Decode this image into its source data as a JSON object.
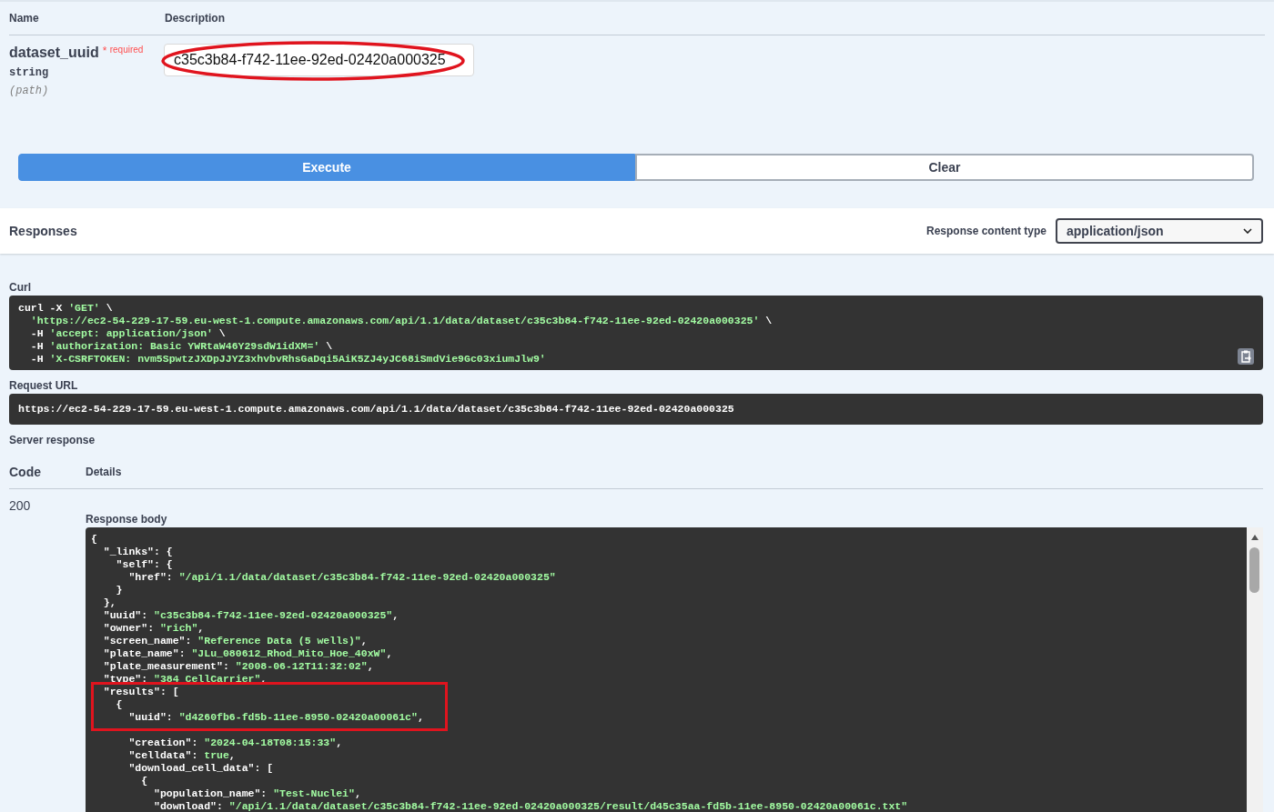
{
  "parameters": {
    "headers": [
      "Name",
      "Description"
    ],
    "param": {
      "name": "dataset_uuid",
      "required_mark": "*",
      "required_label": "required",
      "type": "string",
      "location": "(path)",
      "value": "c35c3b84-f742-11ee-92ed-02420a000325",
      "highlighted": true
    }
  },
  "buttons": {
    "execute": "Execute",
    "clear": "Clear"
  },
  "responses": {
    "title": "Responses",
    "content_type_label": "Response content type",
    "content_type": "application/json"
  },
  "curl": {
    "label": "Curl",
    "lines": [
      "curl -X 'GET' \\",
      "  'https://ec2-54-229-17-59.eu-west-1.compute.amazonaws.com/api/1.1/data/dataset/c35c3b84-f742-11ee-92ed-02420a000325' \\",
      "  -H 'accept: application/json' \\",
      "  -H 'authorization: Basic YWRtaW46Y29sdW1idXM=' \\",
      "  -H 'X-CSRFTOKEN: nvm5SpwtzJXDpJJYZ3xhvbvRhsGaDqi5AiK5ZJ4yJC68iSmdVie9Gc03xiumJlw9'"
    ]
  },
  "request_url": {
    "label": "Request URL",
    "url": "https://ec2-54-229-17-59.eu-west-1.compute.amazonaws.com/api/1.1/data/dataset/c35c3b84-f742-11ee-92ed-02420a000325"
  },
  "server_response": {
    "label": "Server response",
    "headers": [
      "Code",
      "Details"
    ],
    "code": "200",
    "body_label": "Response body",
    "body_lines": [
      "{",
      "  \"_links\": {",
      "    \"self\": {",
      "      \"href\": \"/api/1.1/data/dataset/c35c3b84-f742-11ee-92ed-02420a000325\"",
      "    }",
      "  },",
      "  \"uuid\": \"c35c3b84-f742-11ee-92ed-02420a000325\",",
      "  \"owner\": \"rich\",",
      "  \"screen_name\": \"Reference Data (5 wells)\",",
      "  \"plate_name\": \"JLu_080612_Rhod_Mito_Hoe_40xW\",",
      "  \"plate_measurement\": \"2008-06-12T11:32:02\",",
      "  \"type\": \"384 CellCarrier\",",
      "  \"results\": [",
      "    {",
      "      \"uuid\": \"d4260fb6-fd5b-11ee-8950-02420a00061c\",",
      "      \"creation\": \"2024-04-18T08:15:33\",",
      "      \"celldata\": true,",
      "      \"download_cell_data\": [",
      "        {",
      "          \"population_name\": \"Test-Nuclei\",",
      "          \"download\": \"/api/1.1/data/dataset/c35c3b84-f742-11ee-92ed-02420a000325/result/d45c35aa-fd5b-11ee-8950-02420a00061c.txt\""
    ]
  }
}
